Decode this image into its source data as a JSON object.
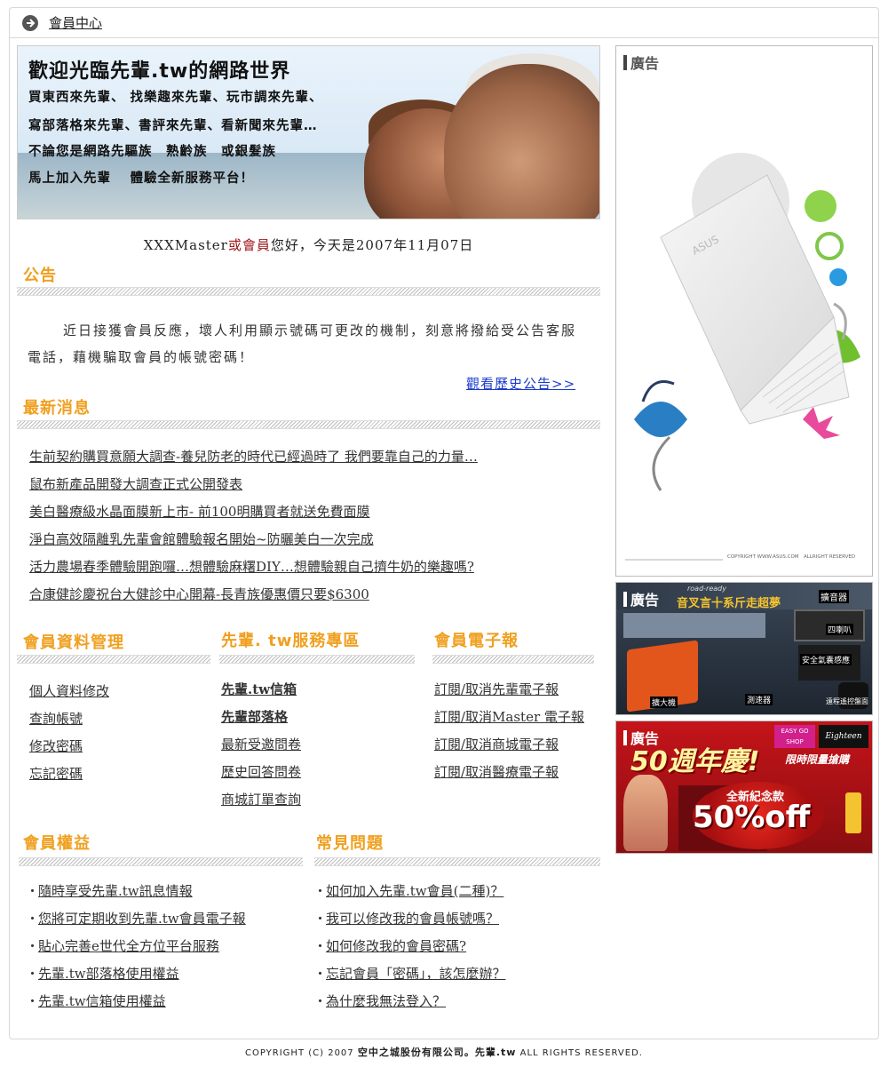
{
  "topbar": {
    "label": "會員中心"
  },
  "hero": {
    "title": "歡迎光臨先輩.tw的網路世界",
    "lines": [
      "買東西來先輩、 找樂趣來先輩、玩市調來先輩、",
      "寫部落格來先輩、書評來先輩、看新聞來先輩…",
      "不論您是網路先驅族　熟齡族　或銀髮族",
      "馬上加入先輩　 體驗全新服務平台！"
    ]
  },
  "greeting": {
    "name": "XXXMaster",
    "or": "或",
    "member": "會員",
    "rest": "您好，今天是2007年11月07日"
  },
  "notice": {
    "title": "公告",
    "body": "近日接獲會員反應，壞人利用顯示號碼可更改的機制，刻意將撥給受公告客服電話，藉機騙取會員的帳號密碼！",
    "more_link": "觀看歷史公告>>"
  },
  "news": {
    "title": "最新消息",
    "items": [
      "生前契約購買意願大調查-養兒防老的時代已經過時了 我們要靠自己的力量…",
      "鼠布新產品開發大調查正式公開發表",
      "美白醫療級水晶面膜新上市- 前100明購買者就送免費面膜",
      "淨白高效隔離乳先輩會館體驗報名開始~防曬美白一次完成",
      "活力農場春季體驗開跑囉…想體驗麻糬DIY…想體驗親自己擠牛奶的樂趣嗎?",
      "合康健診慶祝台大健診中心開幕-長青族優惠價只要$6300"
    ]
  },
  "member_mgmt": {
    "title": "會員資料管理",
    "items": [
      "個人資料修改",
      "查詢帳號",
      "修改密碼",
      "忘記密碼"
    ]
  },
  "services": {
    "title": "先輩. tw服務專區",
    "items": [
      "先輩.tw信箱",
      "先輩部落格",
      "最新受邀問卷",
      "歷史回答問卷",
      "商城訂單查詢"
    ]
  },
  "epaper": {
    "title": "會員電子報",
    "items": [
      "訂閱/取消先輩電子報",
      "訂閱/取消Master 電子報",
      "訂閱/取消商城電子報",
      "訂閱/取消醫療電子報"
    ]
  },
  "benefits": {
    "title": "會員權益",
    "bullet": "・",
    "items": [
      "隨時享受先輩.tw訊息情報",
      "您將可定期收到先輩.tw會員電子報",
      "貼心完善e世代全方位平台服務",
      "先輩.tw部落格使用權益",
      "先輩.tw信箱使用權益"
    ]
  },
  "faq": {
    "title": "常見問題",
    "bullet": "・",
    "items": [
      " 如何加入先輩.tw會員(二種)？ ",
      " 我可以修改我的會員帳號嗎？ ",
      " 如何修改我的會員密碼? ",
      " 忘記會員「密碼」，該怎麼辦？ ",
      " 為什麼我無法登入？ "
    ]
  },
  "ads": {
    "label": "廣告",
    "ad1": {
      "brand": "ASUS",
      "copyright": "COPYRIGHT WWW.ASUS.COM　ALLRIGHT RESERVED"
    },
    "ad2": {
      "headline": "音叉言十系斤走超夢",
      "tag1": "road-ready",
      "labels": [
        "擴音器",
        "四喇叭",
        "安全氣囊感應",
        "擴大機",
        "測速器",
        "遠程遙控盤面"
      ]
    },
    "ad3": {
      "headline": "50週年慶!",
      "sub": "限時限量搶購",
      "badge1": "EASY GO SHOP",
      "badge2": "Eighteen",
      "promo1": "全新紀念款",
      "promo2": "50%off"
    }
  },
  "footer": {
    "pre": "COPYRIGHT (C) 2007 ",
    "company": "空中之城股份有限公司。先輩.tw",
    "post": " ALL RIGHTS RESERVED."
  }
}
